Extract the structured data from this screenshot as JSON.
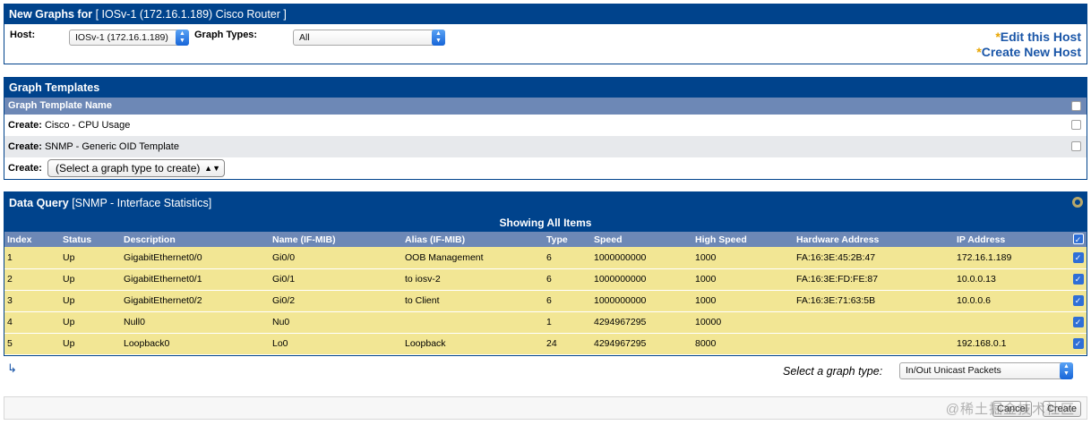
{
  "new_graphs": {
    "title_bold": "New Graphs for",
    "title_rest": "[ IOSv-1 (172.16.1.189) Cisco Router ]",
    "host_label": "Host:",
    "host_value": "IOSv-1 (172.16.1.189)",
    "graph_types_label": "Graph Types:",
    "graph_types_value": "All",
    "edit_host": "Edit this Host",
    "create_host": "Create New Host",
    "star": "*"
  },
  "graph_templates": {
    "title": "Graph Templates",
    "column_header": "Graph Template Name",
    "rows": [
      {
        "prefix": "Create:",
        "name": "Cisco - CPU Usage"
      },
      {
        "prefix": "Create:",
        "name": "SNMP - Generic OID Template"
      }
    ],
    "create_label": "Create:",
    "create_select": "(Select a graph type to create)"
  },
  "data_query": {
    "title_bold": "Data Query",
    "title_rest": "[SNMP - Interface Statistics]",
    "showing": "Showing All Items",
    "columns": [
      "Index",
      "Status",
      "Description",
      "Name (IF-MIB)",
      "Alias (IF-MIB)",
      "Type",
      "Speed",
      "High Speed",
      "Hardware Address",
      "IP Address"
    ],
    "rows": [
      [
        "1",
        "Up",
        "GigabitEthernet0/0",
        "Gi0/0",
        "OOB Management",
        "6",
        "1000000000",
        "1000",
        "FA:16:3E:45:2B:47",
        "172.16.1.189"
      ],
      [
        "2",
        "Up",
        "GigabitEthernet0/1",
        "Gi0/1",
        "to iosv-2",
        "6",
        "1000000000",
        "1000",
        "FA:16:3E:FD:FE:87",
        "10.0.0.13"
      ],
      [
        "3",
        "Up",
        "GigabitEthernet0/2",
        "Gi0/2",
        "to Client",
        "6",
        "1000000000",
        "1000",
        "FA:16:3E:71:63:5B",
        "10.0.0.6"
      ],
      [
        "4",
        "Up",
        "Null0",
        "Nu0",
        "",
        "1",
        "4294967295",
        "10000",
        "",
        ""
      ],
      [
        "5",
        "Up",
        "Loopback0",
        "Lo0",
        "Loopback",
        "24",
        "4294967295",
        "8000",
        "",
        "192.168.0.1"
      ]
    ],
    "select_graph_type_label": "Select a graph type:",
    "select_graph_type_value": "In/Out Unicast Packets"
  },
  "buttons": {
    "cancel": "Cancel",
    "create": "Create"
  },
  "watermark": "@稀土掘金技术社区",
  "colors": {
    "header_blue": "#00438c",
    "subheader_blue": "#6d88b6",
    "row_yellow": "#f2e694",
    "link_blue": "#1a56a8"
  }
}
